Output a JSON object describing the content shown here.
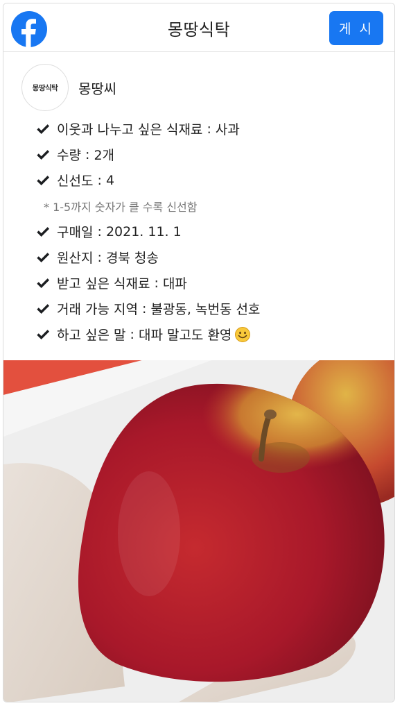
{
  "header": {
    "logo_icon": "facebook-icon",
    "title": "몽땅식탁",
    "post_label": "게 시",
    "accent_color": "#1877f2"
  },
  "author": {
    "avatar_text": "몽땅식탁",
    "name": "몽땅씨"
  },
  "details": [
    {
      "label": "이웃과 나누고 싶은 식재료",
      "sep": " : ",
      "value": "사과"
    },
    {
      "label": "수량",
      "sep": " : ",
      "value": "2개"
    },
    {
      "label": "신선도",
      "sep": " : ",
      "value": "4"
    },
    {
      "label": "구매일",
      "sep": " : ",
      "value": "2021. 11. 1"
    },
    {
      "label": "원산지",
      "sep": " : ",
      "value": "경북 청송"
    },
    {
      "label": "받고 싶은 식재료",
      "sep": " : ",
      "value": "대파"
    },
    {
      "label": "거래 가능 지역",
      "sep": " : ",
      "value": "불광동, 녹번동 선호"
    },
    {
      "label": "하고 싶은 말",
      "sep": " : ",
      "value": "대파 말고도 환영",
      "icon": "smiling-face-icon"
    }
  ],
  "freshness_note": "* 1-5까지 숫자가 클 수록 신선함",
  "photo": {
    "subject": "apple-in-hand",
    "colors": {
      "apple_red": "#b8202a",
      "apple_yellow": "#d9a83a",
      "background": "#f1f1f1"
    }
  }
}
